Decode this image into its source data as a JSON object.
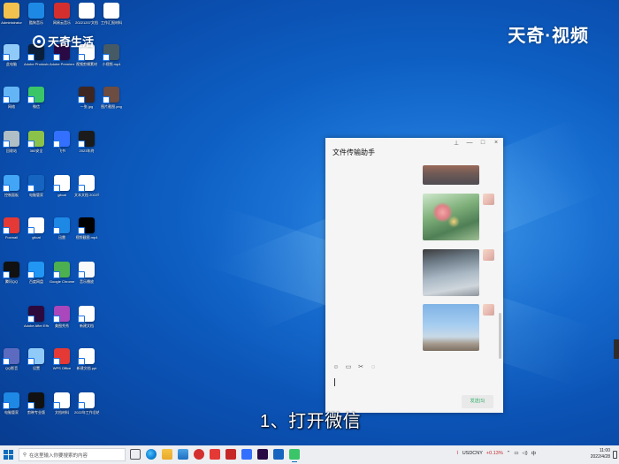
{
  "watermarks": {
    "left_logo": "天奇生活",
    "right_brand": "天奇·视频"
  },
  "desktop_icons": [
    {
      "label": "Administrator",
      "icon": "user-folder-icon",
      "color": "#f2c14e"
    },
    {
      "label": "酷狗音乐",
      "icon": "kugou-icon",
      "color": "#1e88e5"
    },
    {
      "label": "网易云音乐",
      "icon": "netease-music-icon",
      "color": "#d32f2f"
    },
    {
      "label": "20221207文档",
      "icon": "word-doc-icon",
      "color": "#ffffff"
    },
    {
      "label": "工作汇报材料",
      "icon": "word-doc-icon",
      "color": "#ffffff"
    },
    {
      "label": "此电脑",
      "icon": "computer-icon",
      "color": "#90caf9"
    },
    {
      "label": "Adobe Photoshop",
      "icon": "photoshop-icon",
      "color": "#0b1f3a"
    },
    {
      "label": "Adobe Premiere",
      "icon": "premiere-icon",
      "color": "#2a0a44"
    },
    {
      "label": "视频剪辑素材",
      "icon": "text-file-icon",
      "color": "#ffffff"
    },
    {
      "label": "小视频.mp4",
      "icon": "video-file-icon",
      "color": "#455a64"
    },
    {
      "label": "网络",
      "icon": "network-icon",
      "color": "#64b5f6"
    },
    {
      "label": "微信",
      "icon": "wechat-icon",
      "color": "#3ac569"
    },
    {
      "label": "一张.jpg",
      "icon": "image-file-icon",
      "color": "#3e2723"
    },
    {
      "label": "图片截图.png",
      "icon": "image-file-icon",
      "color": "#6d4c41"
    },
    {
      "label": "回收站",
      "icon": "recycle-bin-icon",
      "color": "#b0bec5"
    },
    {
      "label": "360安全",
      "icon": "360-icon",
      "color": "#8bc34a"
    },
    {
      "label": "飞书",
      "icon": "feishu-icon",
      "color": "#3370ff"
    },
    {
      "label": "2023年终",
      "icon": "terminal-icon",
      "color": "#1b1b1b"
    },
    {
      "label": "控制面板",
      "icon": "control-panel-icon",
      "color": "#42a5f5"
    },
    {
      "label": "电脑管家",
      "icon": "pc-manager-icon",
      "color": "#1565c0"
    },
    {
      "label": "gitcat",
      "icon": "text-file-icon",
      "color": "#ffffff"
    },
    {
      "label": "文本文档 2022年",
      "icon": "word-doc-icon",
      "color": "#ffffff"
    },
    {
      "label": "Foxmail",
      "icon": "foxmail-icon",
      "color": "#e53935"
    },
    {
      "label": "gitcat",
      "icon": "text-file-icon",
      "color": "#ffffff"
    },
    {
      "label": "迅雷",
      "icon": "thunder-icon",
      "color": "#1e88e5"
    },
    {
      "label": "视频截图.mp4",
      "icon": "video-file-icon",
      "color": "#000000"
    },
    {
      "label": "腾讯QQ",
      "icon": "qq-icon",
      "color": "#111111"
    },
    {
      "label": "百度网盘",
      "icon": "baidu-netdisk-icon",
      "color": "#2196f3"
    },
    {
      "label": "Google Chrome",
      "icon": "chrome-icon",
      "color": "#4caf50"
    },
    {
      "label": "音乐播放",
      "icon": "speaker-icon",
      "color": "#fafafa"
    },
    {
      "label": "Adobe After Effects",
      "icon": "after-effects-icon",
      "color": "#2d0a3d"
    },
    {
      "label": "美图秀秀",
      "icon": "meitu-icon",
      "color": "#ab47bc"
    },
    {
      "label": "新建文档",
      "icon": "word-doc-icon",
      "color": "#ffffff"
    },
    {
      "label": "QQ影音",
      "icon": "qq-player-icon",
      "color": "#5c6bc0"
    },
    {
      "label": "设置",
      "icon": "settings-icon",
      "color": "#90caf9"
    },
    {
      "label": "WPS Office",
      "icon": "wps-icon",
      "color": "#e53935"
    },
    {
      "label": "新建文档.ppt",
      "icon": "ppt-file-icon",
      "color": "#ffffff"
    },
    {
      "label": "电脑管家",
      "icon": "guard-icon",
      "color": "#1e88e5"
    },
    {
      "label": "剪映专业版",
      "icon": "capcut-icon",
      "color": "#111111"
    },
    {
      "label": "文档材料",
      "icon": "ppt-file-icon",
      "color": "#ffffff"
    },
    {
      "label": "2022年工作总结",
      "icon": "word-doc-icon",
      "color": "#ffffff"
    }
  ],
  "chat_window": {
    "title": "文件传输助手",
    "controls": [
      "pin-icon",
      "minimize-icon",
      "maximize-icon",
      "close-icon"
    ],
    "control_glyphs": [
      "⊥",
      "—",
      "□",
      "×"
    ],
    "toolbar_glyphs": [
      "☺",
      "▭",
      "✂",
      "◌"
    ],
    "send_label": "发送(S)"
  },
  "subtitle": "1、打开微信",
  "taskbar": {
    "search_placeholder": "在这里输入你要搜索的内容",
    "stock_name": "USDCNY",
    "stock_change": "+0.13%",
    "ime": "中",
    "time": "11:00",
    "date": "2022/4/28"
  }
}
